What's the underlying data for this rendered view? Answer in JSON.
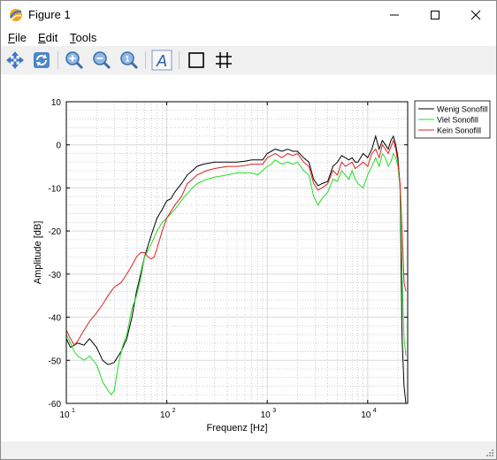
{
  "window": {
    "title": "Figure 1"
  },
  "menu": {
    "file": "File",
    "edit": "Edit",
    "tools": "Tools"
  },
  "toolbar": {
    "buttons": [
      "pan-icon",
      "rotate-icon",
      "zoom-in-icon",
      "zoom-out-icon",
      "zoom-reset-icon",
      "insert-text-icon",
      "axes-box-icon",
      "grid-icon"
    ]
  },
  "chart_data": {
    "type": "line",
    "xlabel": "Frequenz [Hz]",
    "ylabel": "Amplitude [dB]",
    "xscale": "log",
    "xlim": [
      10,
      25000
    ],
    "ylim": [
      -60,
      10
    ],
    "xticks": [
      10,
      100,
      1000,
      10000
    ],
    "xtick_labels": [
      "10",
      "10",
      "10",
      "10"
    ],
    "xtick_exponents": [
      "1",
      "2",
      "3",
      "4"
    ],
    "yticks": [
      10,
      0,
      -10,
      -20,
      -30,
      -40,
      -50,
      -60
    ],
    "grid": true,
    "minor_grid": true,
    "legend_position": "top-right-outside",
    "series": [
      {
        "name": "Wenig Sonofill",
        "color": "#000000",
        "points": [
          [
            10,
            -45
          ],
          [
            11,
            -47
          ],
          [
            13,
            -46
          ],
          [
            15,
            -46.5
          ],
          [
            17,
            -45
          ],
          [
            20,
            -47
          ],
          [
            23,
            -50
          ],
          [
            26,
            -51
          ],
          [
            30,
            -50.5
          ],
          [
            35,
            -48
          ],
          [
            40,
            -45
          ],
          [
            45,
            -40
          ],
          [
            50,
            -34
          ],
          [
            55,
            -30
          ],
          [
            60,
            -26
          ],
          [
            70,
            -21
          ],
          [
            80,
            -17
          ],
          [
            90,
            -15
          ],
          [
            100,
            -13
          ],
          [
            110,
            -12.5
          ],
          [
            120,
            -11
          ],
          [
            140,
            -9
          ],
          [
            160,
            -7
          ],
          [
            180,
            -6
          ],
          [
            200,
            -5
          ],
          [
            230,
            -4.5
          ],
          [
            300,
            -4
          ],
          [
            400,
            -4
          ],
          [
            500,
            -4
          ],
          [
            600,
            -3.8
          ],
          [
            700,
            -3.5
          ],
          [
            800,
            -3.5
          ],
          [
            900,
            -3.5
          ],
          [
            1000,
            -2
          ],
          [
            1100,
            -1.5
          ],
          [
            1200,
            -1
          ],
          [
            1400,
            -1.5
          ],
          [
            1600,
            -1
          ],
          [
            1800,
            -1.5
          ],
          [
            2000,
            -1.5
          ],
          [
            2300,
            -3
          ],
          [
            2600,
            -4
          ],
          [
            2900,
            -8
          ],
          [
            3200,
            -9.5
          ],
          [
            3500,
            -9
          ],
          [
            4000,
            -8.5
          ],
          [
            4500,
            -5
          ],
          [
            5000,
            -4
          ],
          [
            5500,
            -2.5
          ],
          [
            6000,
            -3
          ],
          [
            6500,
            -3.5
          ],
          [
            7000,
            -3
          ],
          [
            7500,
            -4
          ],
          [
            8000,
            -4
          ],
          [
            9000,
            -2
          ],
          [
            10000,
            -3
          ],
          [
            11000,
            -1
          ],
          [
            12000,
            2
          ],
          [
            13000,
            -1
          ],
          [
            14000,
            1
          ],
          [
            15000,
            0
          ],
          [
            16000,
            -1
          ],
          [
            17000,
            1
          ],
          [
            18000,
            2
          ],
          [
            19000,
            0
          ],
          [
            20000,
            -3
          ],
          [
            21000,
            -10
          ],
          [
            22000,
            -45
          ],
          [
            23000,
            -56
          ],
          [
            24000,
            -60
          ]
        ]
      },
      {
        "name": "Viel Sonofill",
        "color": "#22dd22",
        "points": [
          [
            10,
            -44
          ],
          [
            11,
            -46
          ],
          [
            12,
            -48
          ],
          [
            13,
            -49
          ],
          [
            15,
            -50
          ],
          [
            17,
            -49
          ],
          [
            20,
            -51
          ],
          [
            23,
            -55
          ],
          [
            26,
            -57
          ],
          [
            28,
            -58
          ],
          [
            30,
            -57
          ],
          [
            33,
            -51
          ],
          [
            36,
            -47
          ],
          [
            40,
            -44
          ],
          [
            45,
            -38
          ],
          [
            50,
            -35
          ],
          [
            55,
            -31
          ],
          [
            60,
            -26
          ],
          [
            70,
            -23
          ],
          [
            80,
            -20
          ],
          [
            90,
            -18
          ],
          [
            100,
            -17
          ],
          [
            120,
            -15
          ],
          [
            150,
            -12
          ],
          [
            180,
            -10
          ],
          [
            200,
            -9
          ],
          [
            250,
            -8
          ],
          [
            300,
            -7.5
          ],
          [
            400,
            -7
          ],
          [
            500,
            -6.5
          ],
          [
            600,
            -6.5
          ],
          [
            700,
            -6.5
          ],
          [
            800,
            -7
          ],
          [
            900,
            -6
          ],
          [
            1000,
            -5
          ],
          [
            1100,
            -4.5
          ],
          [
            1200,
            -3.5
          ],
          [
            1400,
            -4.5
          ],
          [
            1600,
            -4
          ],
          [
            1800,
            -4.5
          ],
          [
            2000,
            -4
          ],
          [
            2300,
            -6
          ],
          [
            2600,
            -7
          ],
          [
            2900,
            -12
          ],
          [
            3200,
            -14
          ],
          [
            3500,
            -12.5
          ],
          [
            4000,
            -11
          ],
          [
            4500,
            -8
          ],
          [
            5000,
            -8.5
          ],
          [
            5500,
            -6
          ],
          [
            6000,
            -7
          ],
          [
            6500,
            -8
          ],
          [
            7000,
            -6
          ],
          [
            7500,
            -8
          ],
          [
            8000,
            -9
          ],
          [
            9000,
            -10
          ],
          [
            10000,
            -7
          ],
          [
            11000,
            -5
          ],
          [
            12000,
            -3
          ],
          [
            13000,
            -5
          ],
          [
            14000,
            -2
          ],
          [
            15000,
            -3
          ],
          [
            16000,
            -5
          ],
          [
            17000,
            -4
          ],
          [
            18000,
            -2
          ],
          [
            19000,
            -3
          ],
          [
            20000,
            -5
          ],
          [
            21000,
            -10
          ],
          [
            22000,
            -30
          ],
          [
            23000,
            -45
          ],
          [
            24000,
            -49
          ]
        ]
      },
      {
        "name": "Kein Sonofill",
        "color": "#dd2222",
        "points": [
          [
            10,
            -43
          ],
          [
            11,
            -45
          ],
          [
            12,
            -46.5
          ],
          [
            13,
            -45.5
          ],
          [
            15,
            -43
          ],
          [
            17,
            -41
          ],
          [
            20,
            -39
          ],
          [
            23,
            -37
          ],
          [
            26,
            -35
          ],
          [
            30,
            -33
          ],
          [
            35,
            -32
          ],
          [
            40,
            -30
          ],
          [
            45,
            -28
          ],
          [
            50,
            -26
          ],
          [
            55,
            -25
          ],
          [
            60,
            -25
          ],
          [
            65,
            -26
          ],
          [
            70,
            -26.5
          ],
          [
            75,
            -26
          ],
          [
            80,
            -24
          ],
          [
            90,
            -20
          ],
          [
            100,
            -17
          ],
          [
            120,
            -14
          ],
          [
            140,
            -12
          ],
          [
            160,
            -9
          ],
          [
            180,
            -8
          ],
          [
            200,
            -7
          ],
          [
            250,
            -6
          ],
          [
            300,
            -5.5
          ],
          [
            400,
            -5
          ],
          [
            500,
            -5
          ],
          [
            600,
            -4.8
          ],
          [
            700,
            -4.5
          ],
          [
            800,
            -4.5
          ],
          [
            900,
            -4.5
          ],
          [
            1000,
            -3
          ],
          [
            1100,
            -2.5
          ],
          [
            1200,
            -2
          ],
          [
            1400,
            -3
          ],
          [
            1600,
            -2
          ],
          [
            1800,
            -2.5
          ],
          [
            2000,
            -2
          ],
          [
            2300,
            -4
          ],
          [
            2600,
            -5
          ],
          [
            2900,
            -9
          ],
          [
            3200,
            -10.5
          ],
          [
            3500,
            -10
          ],
          [
            4000,
            -9
          ],
          [
            4500,
            -6
          ],
          [
            5000,
            -7
          ],
          [
            5500,
            -4
          ],
          [
            6000,
            -5
          ],
          [
            6500,
            -4.5
          ],
          [
            7000,
            -4
          ],
          [
            7500,
            -5.5
          ],
          [
            8000,
            -5
          ],
          [
            9000,
            -4
          ],
          [
            10000,
            -5
          ],
          [
            11000,
            -2
          ],
          [
            12000,
            -1
          ],
          [
            13000,
            -3
          ],
          [
            14000,
            0
          ],
          [
            15000,
            -1
          ],
          [
            16000,
            -2
          ],
          [
            17000,
            -0.5
          ],
          [
            18000,
            1
          ],
          [
            19000,
            -1
          ],
          [
            20000,
            -4
          ],
          [
            21000,
            -9
          ],
          [
            22000,
            -20
          ],
          [
            23000,
            -32
          ],
          [
            24000,
            -34
          ]
        ]
      }
    ]
  }
}
